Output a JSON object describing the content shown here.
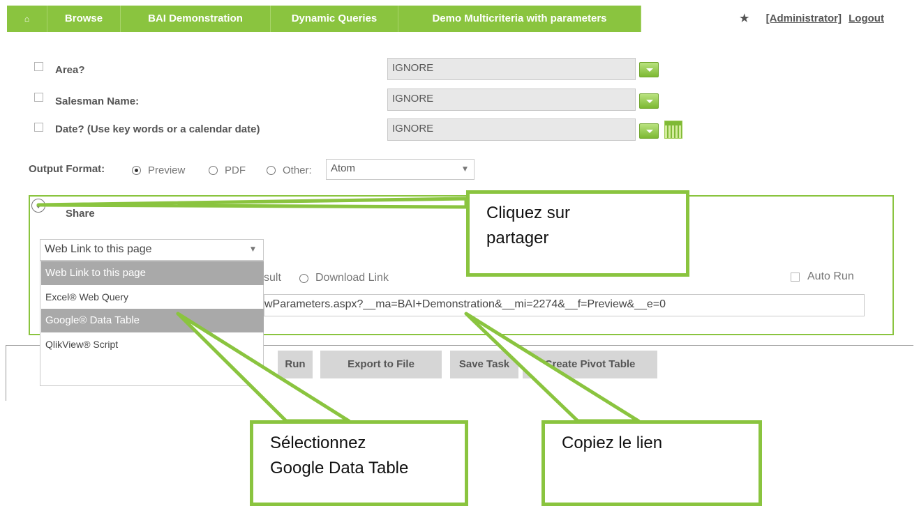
{
  "nav": {
    "home_icon": "⌂",
    "items": [
      "Browse",
      "BAI Demonstration",
      "Dynamic Queries",
      "Demo Multicriteria with parameters"
    ],
    "star": "★",
    "user": "[Administrator]",
    "logout": "Logout"
  },
  "params": [
    {
      "label": "Area?",
      "value": "IGNORE"
    },
    {
      "label": "Salesman Name:",
      "value": "IGNORE"
    },
    {
      "label": "Date? (Use key words or a calendar date)",
      "value": "IGNORE"
    }
  ],
  "output": {
    "label": "Output Format:",
    "options": [
      "Preview",
      "PDF",
      "Other:"
    ],
    "selected": "Preview",
    "other_value": "Atom"
  },
  "share": {
    "label": "Share",
    "selected": "Web Link to this page",
    "options": [
      "Web Link to this page",
      "Excel® Web Query",
      "Google® Data Table",
      "QlikView® Script"
    ],
    "highlighted": "Google® Data Table",
    "result_partial": "sult",
    "download_link": "Download Link",
    "auto_run": "Auto Run",
    "url": "wParameters.aspx?__ma=BAI+Demonstration&__mi=2274&__f=Preview&__e=0"
  },
  "actions": {
    "run": "Run",
    "export": "Export to File",
    "save": "Save Task",
    "pivot": "Create Pivot Table"
  },
  "callouts": {
    "share": [
      "Cliquez sur",
      "partager"
    ],
    "google": [
      "Sélectionnez",
      "Google Data Table"
    ],
    "link": [
      "Copiez le lien"
    ]
  },
  "colors": {
    "accent": "#8ac43f",
    "button_bg": "#d6d6d6",
    "dropdown_highlight": "#a9a9a9"
  }
}
